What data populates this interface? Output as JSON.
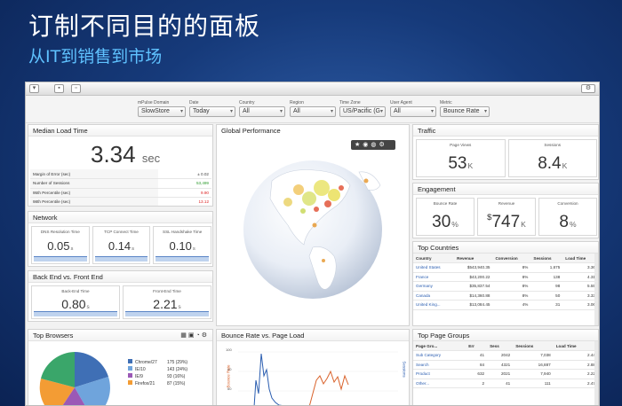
{
  "slide": {
    "title": "订制不同目的的面板",
    "subtitle": "从IT到销售到市场"
  },
  "filters": [
    {
      "label": "mPulse Domain",
      "value": "SlowStore"
    },
    {
      "label": "Date",
      "value": "Today"
    },
    {
      "label": "Country",
      "value": "All"
    },
    {
      "label": "Region",
      "value": "All"
    },
    {
      "label": "Time Zone",
      "value": "US/Pacific (G"
    },
    {
      "label": "User Agent",
      "value": "All"
    },
    {
      "label": "Metric",
      "value": "Bounce Rate"
    }
  ],
  "median": {
    "title": "Median Load Time",
    "value": "3.34",
    "unit": "sec",
    "rows": [
      {
        "label": "Margin of Error (sec)",
        "value": "± 0.02",
        "color": "#444"
      },
      {
        "label": "Number of Sessions",
        "value": "53,499",
        "color": "#2e9b2e"
      },
      {
        "label": "95th Percentile (sec)",
        "value": "9.90",
        "color": "#d22"
      },
      {
        "label": "98th Percentile (sec)",
        "value": "13.12",
        "color": "#d22"
      }
    ]
  },
  "network": {
    "title": "Network",
    "items": [
      {
        "label": "DNS Resolution Time",
        "value": "0.05",
        "unit": "s"
      },
      {
        "label": "TCP Connect Time",
        "value": "0.14",
        "unit": "s"
      },
      {
        "label": "SSL Handshake Time",
        "value": "0.10",
        "unit": "s"
      }
    ]
  },
  "backfront": {
    "title": "Back End vs. Front End",
    "items": [
      {
        "label": "Back-End Time",
        "value": "0.80",
        "unit": "s"
      },
      {
        "label": "Front-End Time",
        "value": "2.21",
        "unit": "s"
      }
    ]
  },
  "global": {
    "title": "Global Performance"
  },
  "traffic": {
    "title": "Traffic",
    "items": [
      {
        "label": "Page Views",
        "value": "53",
        "unit": "K"
      },
      {
        "label": "Sessions",
        "value": "8.4",
        "unit": "K"
      }
    ]
  },
  "engagement": {
    "title": "Engagement",
    "items": [
      {
        "label": "Bounce Rate",
        "prefix": "",
        "value": "30",
        "unit": "%"
      },
      {
        "label": "Revenue",
        "prefix": "$",
        "value": "747",
        "unit": "K"
      },
      {
        "label": "Conversion",
        "prefix": "",
        "value": "8",
        "unit": "%"
      }
    ]
  },
  "countries": {
    "title": "Top Countries",
    "columns": [
      "Country",
      "Revenue",
      "Conversion",
      "Sessions",
      "Load Time"
    ],
    "rows": [
      [
        "United States",
        "$543,940.35",
        "8%",
        "1,675",
        "3.36"
      ],
      [
        "France",
        "$43,200.22",
        "8%",
        "138",
        "4.31"
      ],
      [
        "Germany",
        "$35,837.54",
        "8%",
        "98",
        "5.55"
      ],
      [
        "Canada",
        "$14,360.88",
        "8%",
        "50",
        "3.33"
      ],
      [
        "United King...",
        "$13,084.45",
        "4%",
        "31",
        "3.06"
      ]
    ]
  },
  "browsers": {
    "title": "Top Browsers",
    "legend": [
      {
        "label": "Chrome/27",
        "value": "175 (29%)",
        "color": "#3f6fb5"
      },
      {
        "label": "IE/10",
        "value": "143 (24%)",
        "color": "#6fa4dc"
      },
      {
        "label": "IE/9",
        "value": "93 (16%)",
        "color": "#9b59b6"
      },
      {
        "label": "Firefox/21",
        "value": "87 (15%)",
        "color": "#f39c34"
      }
    ]
  },
  "bounce": {
    "title": "Bounce Rate vs. Page Load",
    "ylabel": "Bounce Rate",
    "ylabel_right": "Sessions",
    "ticks": [
      "100",
      "80",
      "60"
    ]
  },
  "pagegroups": {
    "title": "Top Page Groups",
    "columns": [
      "Page Gro...",
      "Err",
      "Sess",
      "Sessions",
      "Load Time"
    ],
    "rows": [
      [
        "Sub Category",
        "41",
        "2042",
        "7,038",
        "2.44"
      ],
      [
        "Search",
        "84",
        "4321",
        "16,887",
        "2.88"
      ],
      [
        "Product",
        "632",
        "2021",
        "7,940",
        "2.22"
      ],
      [
        "Other...",
        "2",
        "41",
        "111",
        "2.47"
      ]
    ]
  },
  "colors": {
    "accent": "#2a5db0",
    "spark": "#bfd3ee",
    "title_sub": "#5fc2ff"
  },
  "icons": [
    "settings-icon",
    "star-icon",
    "target-icon",
    "globe-icon",
    "gear-icon"
  ]
}
